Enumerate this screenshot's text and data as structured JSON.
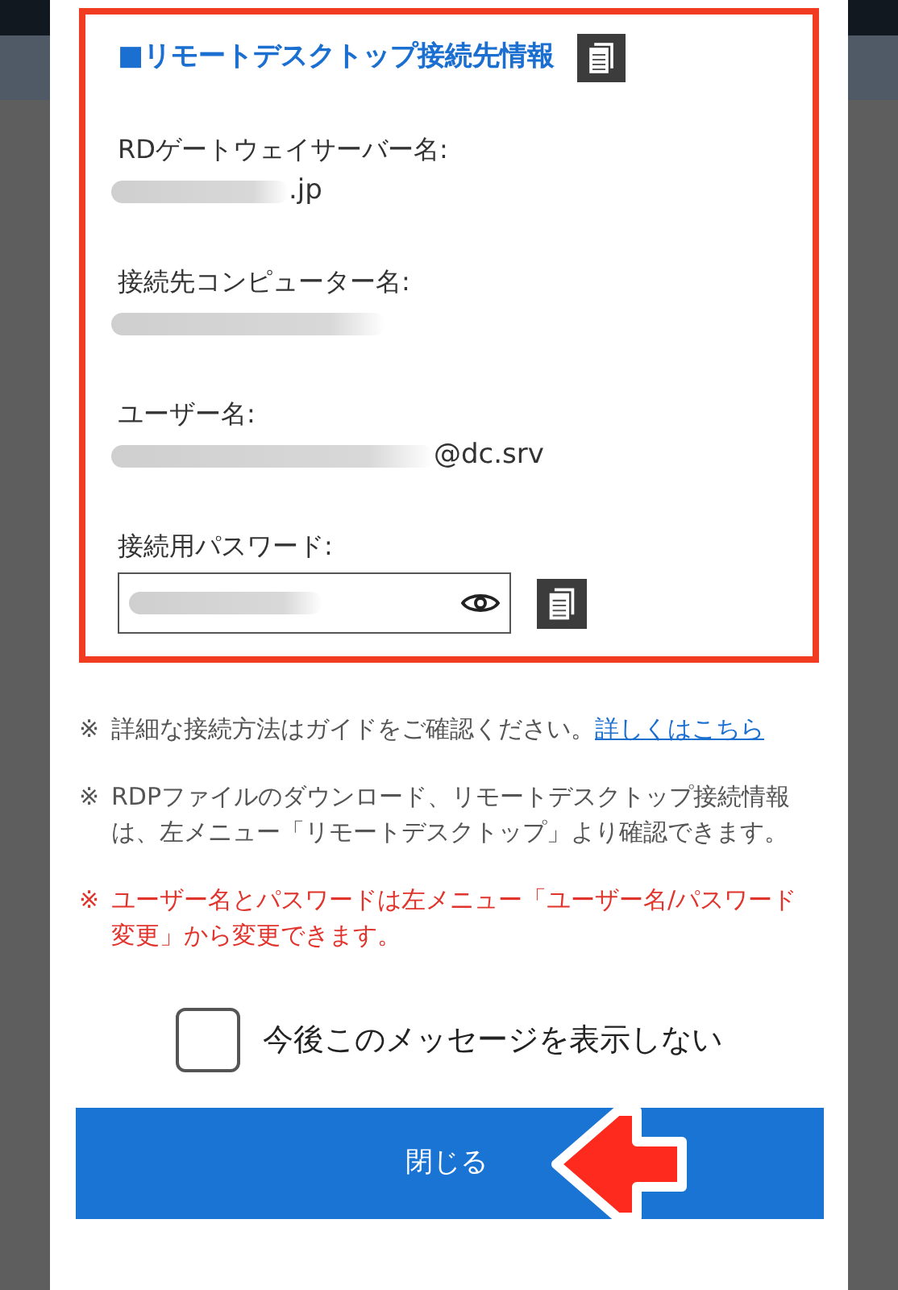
{
  "connection_info": {
    "title": "■リモートデスクトップ接続先情報",
    "fields": [
      {
        "label": "RDゲートウェイサーバー名:",
        "value_suffix": ".jp"
      },
      {
        "label": "接続先コンピューター名:"
      },
      {
        "label": "ユーザー名:",
        "value_suffix": "@dc.srv"
      }
    ],
    "password": {
      "label": "接続用パスワード:"
    }
  },
  "notes": [
    {
      "kind": "info",
      "mark": "※",
      "text": "詳細な接続方法はガイドをご確認ください。",
      "link": "詳しくはこちら"
    },
    {
      "kind": "info",
      "mark": "※",
      "text": "RDPファイルのダウンロード、リモートデスクトップ接続情報は、左メニュー「リモートデスクトップ」より確認できます。"
    },
    {
      "kind": "warning",
      "mark": "※",
      "text": "ユーザー名とパスワードは左メニュー「ユーザー名/パスワード変更」から変更できます。"
    }
  ],
  "dont_show_again": {
    "label": "今後このメッセージを表示しない",
    "checked": false
  },
  "close_button": "閉じる"
}
